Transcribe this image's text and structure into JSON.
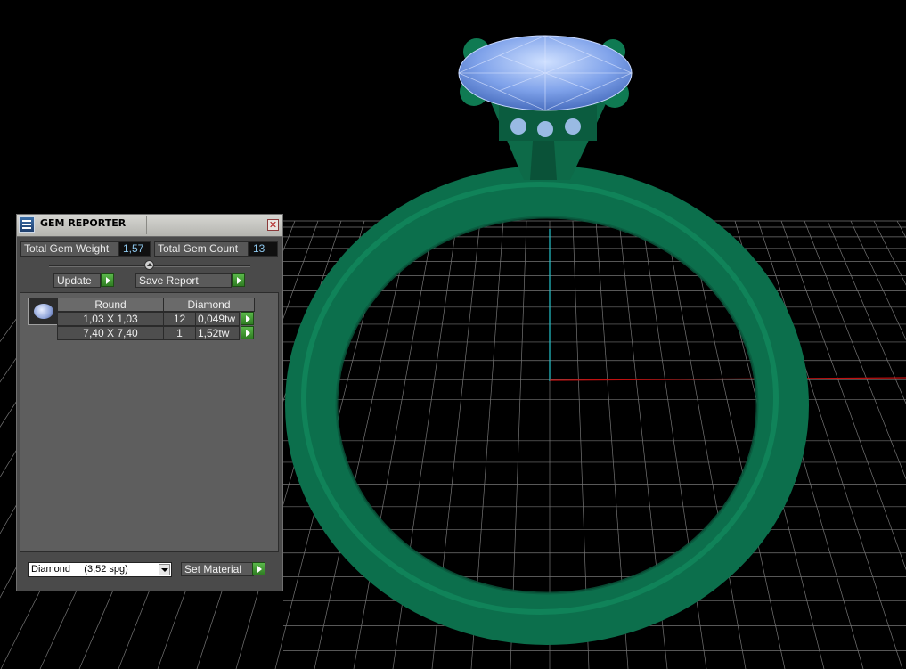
{
  "app": {
    "panel_title": "GEM REPORTER",
    "close_glyph": "✕"
  },
  "summary": {
    "weight_label": "Total Gem Weight",
    "weight_value": "1,57",
    "count_label": "Total Gem Count",
    "count_value": "13"
  },
  "actions": {
    "update_label": "Update",
    "save_report_label": "Save Report"
  },
  "gem_table": {
    "headers": [
      "Round",
      "Diamond"
    ],
    "rows": [
      {
        "size": "1,03 X 1,03",
        "qty": "12",
        "weight": "0,049tw"
      },
      {
        "size": "7,40 X 7,40",
        "qty": "1",
        "weight": "1,52tw"
      }
    ]
  },
  "material": {
    "selected": "Diamond     (3,52 spg)",
    "set_material_label": "Set Material"
  },
  "scene": {
    "ring_color": "#0c6f4c",
    "gem_color": "#8fb2ef",
    "grid_color": "#8a8a8a",
    "axis_x_color": "#c01010",
    "axis_y_color": "#26c4cc"
  }
}
